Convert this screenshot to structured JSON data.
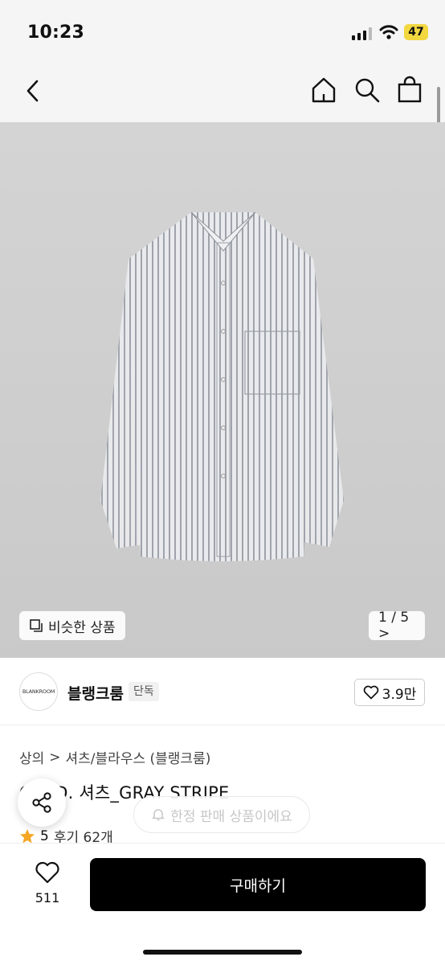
{
  "status_bar": {
    "time": "10:23",
    "battery": "47"
  },
  "nav": {
    "back_icon": "chevron-left-icon",
    "home_icon": "home-icon",
    "search_icon": "search-icon",
    "cart_icon": "shopping-bag-icon"
  },
  "gallery": {
    "similar_label": "비슷한 상품",
    "page_indicator": "1 / 5 >"
  },
  "brand": {
    "logo_text": "BLANKROOM",
    "name": "블랭크룸",
    "badge": "단독",
    "likes": "3.9만"
  },
  "breadcrumb": {
    "category": "상의",
    "separator": ">",
    "subcategory": "셔츠/블라우스 (블랭크룸)"
  },
  "product": {
    "title": "O.B.D. 셔츠_GRAY STRIPE",
    "rating": "5",
    "reviews": "후기 62개"
  },
  "toast": {
    "text": "한정 판매 상품이에요"
  },
  "bottom_bar": {
    "wish_count": "511",
    "buy_label": "구매하기"
  },
  "colors": {
    "accent": "#000000",
    "star": "#f5a623",
    "battery": "#f2d740"
  }
}
